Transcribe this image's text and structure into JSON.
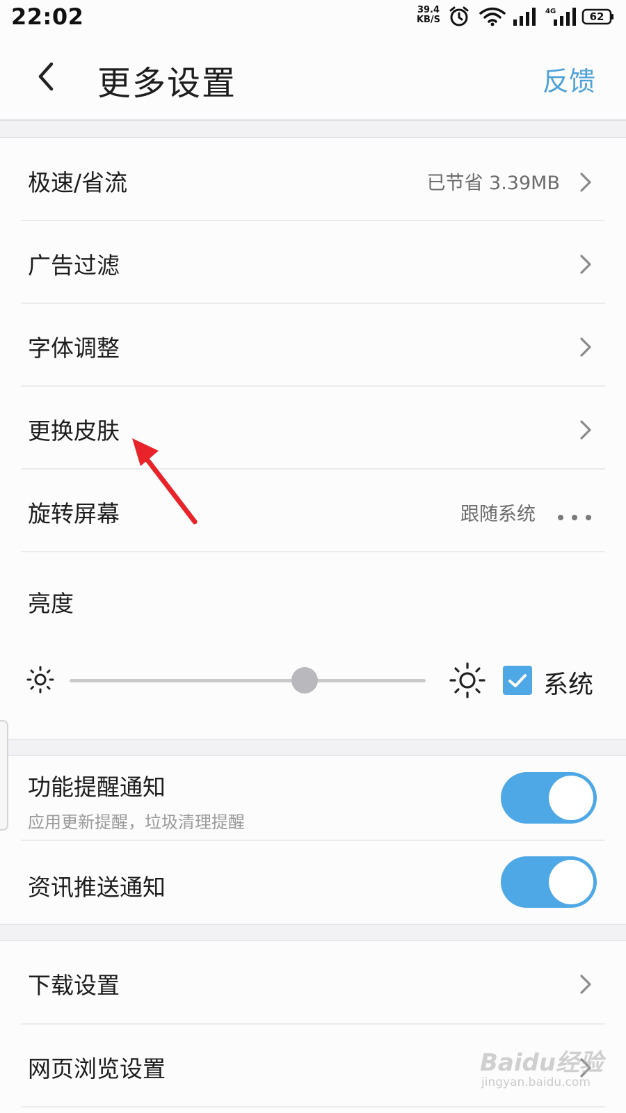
{
  "status_bar": {
    "time": "22:02",
    "net_speed_value": "39.4",
    "net_speed_unit": "KB/S",
    "network_type": "4G",
    "battery": "62"
  },
  "header": {
    "title": "更多设置",
    "feedback_label": "反馈"
  },
  "settings": {
    "speed_mode": {
      "label": "极速/省流",
      "value": "已节省 3.39MB"
    },
    "ad_filter": {
      "label": "广告过滤"
    },
    "font_adjust": {
      "label": "字体调整"
    },
    "change_skin": {
      "label": "更换皮肤"
    },
    "rotate_screen": {
      "label": "旋转屏幕",
      "value": "跟随系统"
    },
    "brightness": {
      "label": "亮度",
      "level": 0.66,
      "system_label": "系统",
      "system_checked": true
    }
  },
  "notifications": {
    "feature_reminder": {
      "label": "功能提醒通知",
      "subtitle": "应用更新提醒，垃圾清理提醒",
      "enabled": true
    },
    "news_push": {
      "label": "资讯推送通知",
      "enabled": true
    }
  },
  "more": {
    "download_settings": {
      "label": "下载设置"
    },
    "browse_settings": {
      "label": "网页浏览设置"
    }
  },
  "watermark": {
    "logo": "Baidu经验",
    "url": "jingyan.baidu.com"
  },
  "colors": {
    "accent": "#4ea8e6",
    "link": "#4ea2d8",
    "annotation_arrow": "#e8232a"
  }
}
